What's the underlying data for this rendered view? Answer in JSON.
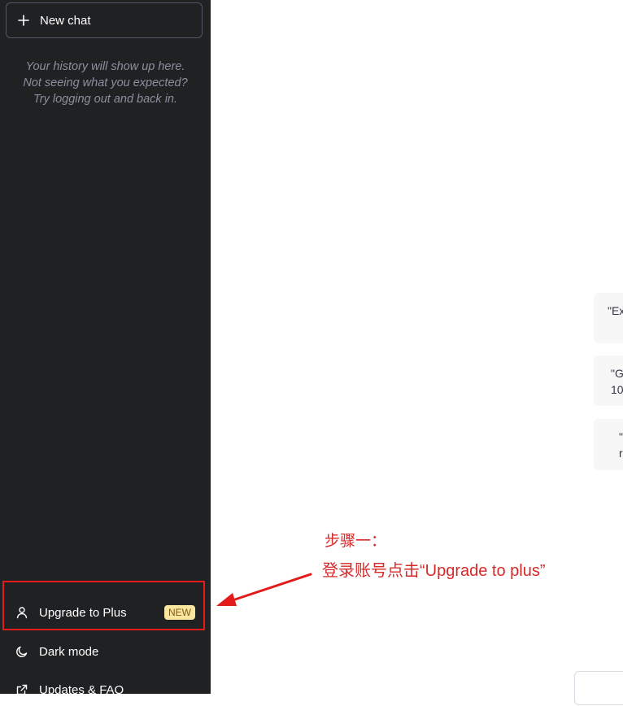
{
  "sidebar": {
    "new_chat_label": "New chat",
    "history_note": [
      "Your history will show up here.",
      "Not seeing what you expected?",
      "Try logging out and back in."
    ],
    "items": [
      {
        "label": "Upgrade to Plus",
        "icon": "user-icon",
        "badge": "NEW"
      },
      {
        "label": "Dark mode",
        "icon": "moon-icon"
      },
      {
        "label": "Updates & FAQ",
        "icon": "external-link-icon"
      }
    ]
  },
  "main": {
    "example_cards": [
      {
        "lines": [
          "\"Ex"
        ]
      },
      {
        "lines": [
          "\"G",
          "10"
        ]
      },
      {
        "lines": [
          "\"",
          "r"
        ]
      }
    ]
  },
  "annotation": {
    "step": "步骤一：",
    "instruction": "登录账号点击“Upgrade to plus”"
  },
  "colors": {
    "sidebar_bg": "#202123",
    "annotation_red": "#e31b1b",
    "badge_bg": "#fae69e"
  }
}
